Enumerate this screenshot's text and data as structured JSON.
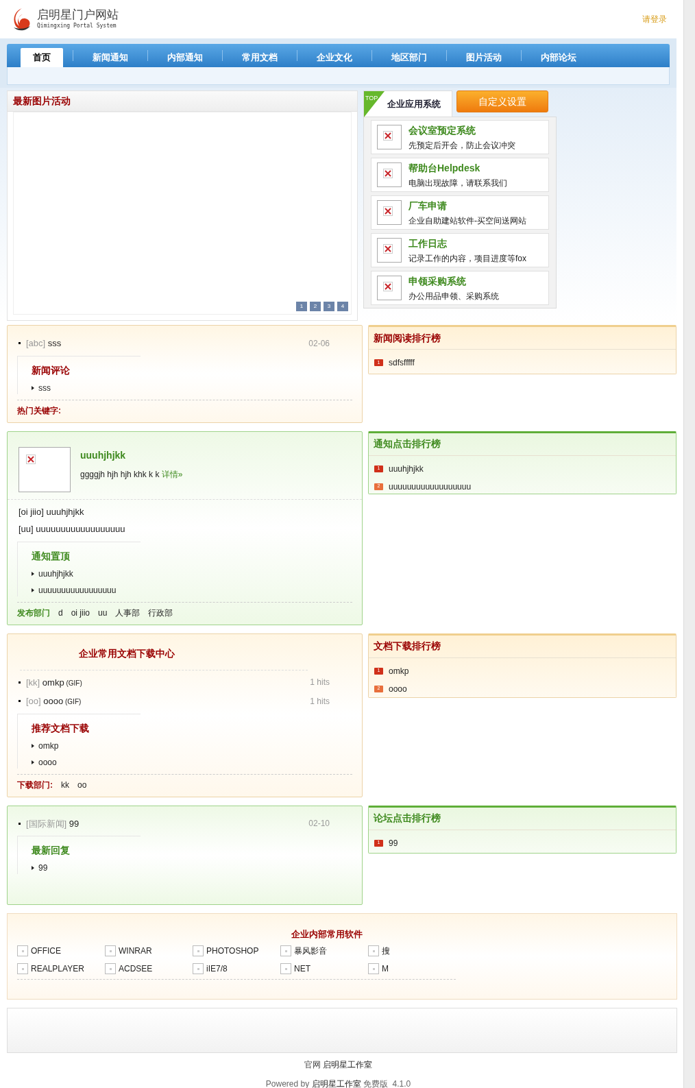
{
  "header": {
    "title": "启明星门户网站",
    "subtitle": "Qimingxing Portal System",
    "login": "请登录"
  },
  "nav": [
    {
      "label": "首页",
      "selected": true
    },
    {
      "label": "新闻通知",
      "selected": false
    },
    {
      "label": "内部通知",
      "selected": false
    },
    {
      "label": "常用文档",
      "selected": false
    },
    {
      "label": "企业文化",
      "selected": false
    },
    {
      "label": "地区部门",
      "selected": false
    },
    {
      "label": "图片活动",
      "selected": false
    },
    {
      "label": "内部论坛",
      "selected": false
    }
  ],
  "photo_panel": {
    "title": "最新图片活动",
    "pages": [
      "1",
      "2",
      "3",
      "4"
    ]
  },
  "app_panel": {
    "badge": "TOP",
    "tab": "企业应用系统",
    "button": "自定义设置",
    "apps": [
      {
        "title": "会议室预定系统",
        "desc": "先预定后开会，防止会议冲突"
      },
      {
        "title": "帮助台Helpdesk",
        "desc": "电脑出现故障，请联系我们"
      },
      {
        "title": "厂车申请",
        "desc": "企业自助建站软件-买空间送网站"
      },
      {
        "title": "工作日志",
        "desc": "记录工作的内容，项目进度等fox"
      },
      {
        "title": "申领采购系统",
        "desc": "办公用品申领、采购系统"
      }
    ]
  },
  "rows": [
    {
      "kind": "orange",
      "blocks": [
        {
          "kind": "news",
          "items": [
            {
              "tag": "[abc]",
              "title": "sss",
              "meta": "02-06"
            }
          ]
        },
        {
          "kind": "sub",
          "title": "新闻评论",
          "items": [
            "sss"
          ]
        },
        {
          "kind": "tags",
          "label": "热门关键字:"
        }
      ],
      "rank": {
        "title": "新闻阅读排行榜",
        "items": [
          {
            "rank": "1",
            "text": "sdfsfffff"
          }
        ]
      }
    },
    {
      "kind": "green",
      "blocks": [
        {
          "kind": "feature",
          "title": "uuuhjhjkk",
          "text": "ggggjh hjh hjh khk k k",
          "link": "详情»"
        },
        {
          "kind": "plain",
          "items": [
            "[oi jiio] uuuhjhjkk",
            "[uu] uuuuuuuuuuuuuuuuuu"
          ]
        },
        {
          "kind": "sub",
          "title": "通知置顶",
          "items": [
            "uuuhjhjkk",
            "uuuuuuuuuuuuuuuuu"
          ]
        },
        {
          "kind": "tags",
          "label": "发布部门",
          "items": [
            "d",
            "oi jiio",
            "uu",
            "人事部",
            "行政部"
          ]
        }
      ],
      "rank": {
        "title": "通知点击排行榜",
        "items": [
          {
            "rank": "1",
            "text": "uuuhjhjkk"
          },
          {
            "rank": "2",
            "text": "uuuuuuuuuuuuuuuuuu"
          }
        ]
      }
    },
    {
      "kind": "orange",
      "blocks": [
        {
          "kind": "heading",
          "text": "企业常用文档下载中心"
        },
        {
          "kind": "news",
          "items": [
            {
              "tag": "[kk]",
              "title": "omkp",
              "format": "(GIF)",
              "meta": "1 hits"
            },
            {
              "tag": "[oo]",
              "title": "oooo",
              "format": "(GIF)",
              "meta": "1 hits"
            }
          ]
        },
        {
          "kind": "sub",
          "title": "推荐文档下载",
          "items": [
            "omkp",
            "oooo"
          ]
        },
        {
          "kind": "tags",
          "label": "下载部门:",
          "items": [
            "kk",
            "oo"
          ]
        }
      ],
      "rank": {
        "title": "文档下载排行榜",
        "items": [
          {
            "rank": "1",
            "text": "omkp"
          },
          {
            "rank": "2",
            "text": "oooo"
          }
        ]
      }
    },
    {
      "kind": "green",
      "blocks": [
        {
          "kind": "news",
          "items": [
            {
              "tag": "[国际新闻]",
              "title": "99",
              "meta": "02-10"
            }
          ]
        },
        {
          "kind": "sub",
          "title": "最新回复",
          "items": [
            "99"
          ]
        }
      ],
      "rank": {
        "title": "论坛点击排行榜",
        "items": [
          {
            "rank": "1",
            "text": "99"
          }
        ]
      }
    }
  ],
  "software": {
    "title": "企业内部常用软件",
    "items": [
      "OFFICE",
      "WINRAR",
      "PHOTOSHOP",
      "暴风影音",
      "搜",
      "REALPLAYER",
      "ACDSEE",
      "iIE7/8",
      "NET",
      "M"
    ]
  },
  "footer": {
    "site_label": "官网",
    "site_link": "启明星工作室",
    "powered": "Powered by",
    "powered_link": "启明星工作室",
    "edition": "免费版",
    "version": "4.1.0"
  }
}
